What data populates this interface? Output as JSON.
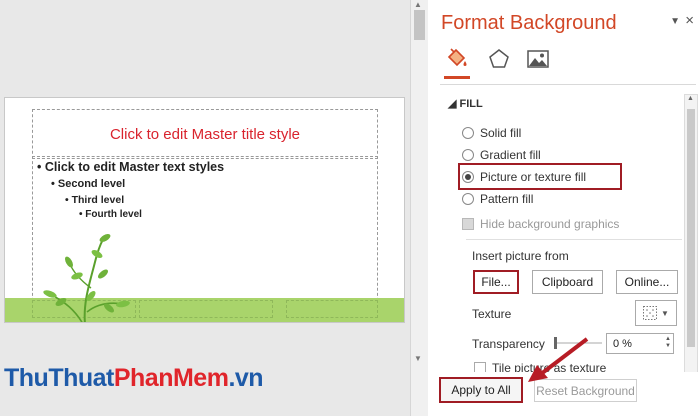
{
  "slide": {
    "title": "Click to edit Master title style",
    "level1": "• Click to edit Master text styles",
    "level2": "• Second level",
    "level3": "• Third level",
    "level4": "• Fourth level"
  },
  "watermark": {
    "part1": "ThuThuat",
    "part2": "PhanMem",
    "part3": ".vn"
  },
  "pane": {
    "title": "Format Background",
    "dropdown_icon": "chevron-down-icon",
    "close_icon": "close-icon",
    "tabs": [
      "fill-bucket-icon",
      "pentagon-icon",
      "picture-icon"
    ],
    "section": "FILL",
    "options": {
      "solid": "Solid fill",
      "gradient": "Gradient fill",
      "picture": "Picture or texture fill",
      "pattern": "Pattern fill"
    },
    "selected": "Picture or texture fill",
    "hide_graphics": "Hide background graphics",
    "insert_from": "Insert picture from",
    "buttons": {
      "file": "File...",
      "clipboard": "Clipboard",
      "online": "Online..."
    },
    "texture_label": "Texture",
    "transparency_label": "Transparency",
    "transparency_value": "0 %",
    "tile_label": "Tile picture as texture",
    "apply_all": "Apply to All",
    "reset": "Reset Background"
  },
  "colors": {
    "accent": "#d24726",
    "highlight": "#a01c24",
    "title_red": "#d9232d",
    "green_strip": "#a9d46b"
  }
}
